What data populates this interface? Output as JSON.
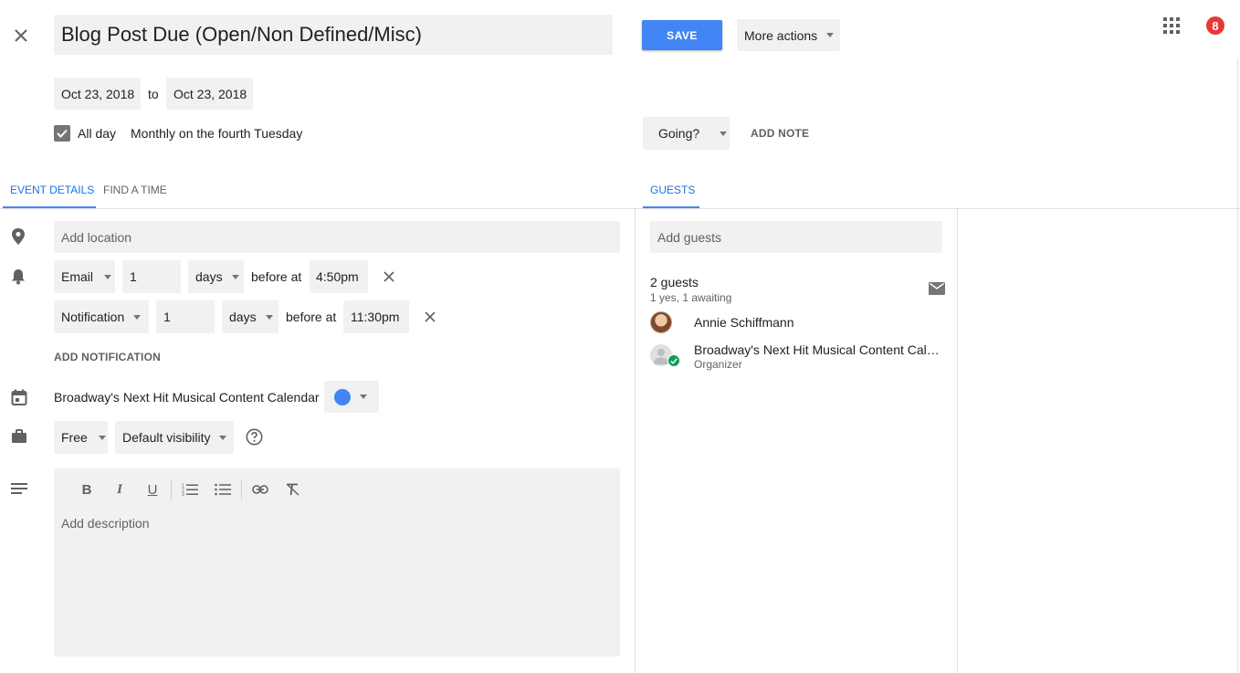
{
  "header": {
    "title": "Blog Post Due (Open/Non Defined/Misc)",
    "save_label": "SAVE",
    "more_actions_label": "More actions",
    "notification_count": "8"
  },
  "dates": {
    "start": "Oct 23, 2018",
    "to_label": "to",
    "end": "Oct 23, 2018",
    "all_day_label": "All day",
    "all_day_checked": true,
    "recurrence": "Monthly on the fourth Tuesday"
  },
  "rsvp": {
    "going_label": "Going?",
    "add_note_label": "ADD NOTE"
  },
  "tabs": {
    "event_details": "EVENT DETAILS",
    "find_a_time": "FIND A TIME",
    "guests": "GUESTS"
  },
  "details": {
    "location_placeholder": "Add location",
    "notifications": [
      {
        "method": "Email",
        "quantity": "1",
        "unit": "days",
        "before_at": "before at",
        "time": "4:50pm"
      },
      {
        "method": "Notification",
        "quantity": "1",
        "unit": "days",
        "before_at": "before at",
        "time": "11:30pm"
      }
    ],
    "add_notification_label": "ADD NOTIFICATION",
    "calendar_name": "Broadway's Next Hit Musical Content Calendar",
    "calendar_color": "#4285f4",
    "availability": "Free",
    "visibility": "Default visibility",
    "description_placeholder": "Add description"
  },
  "guests": {
    "placeholder": "Add guests",
    "count_label": "2 guests",
    "status_label": "1 yes, 1 awaiting",
    "list": [
      {
        "name": "Annie Schiffmann",
        "role": ""
      },
      {
        "name": "Broadway's Next Hit Musical Content Calendar",
        "role": "Organizer"
      }
    ]
  },
  "colors": {
    "accent": "#4285f4",
    "badge": "#e53935",
    "accepted": "#0f9d58"
  }
}
